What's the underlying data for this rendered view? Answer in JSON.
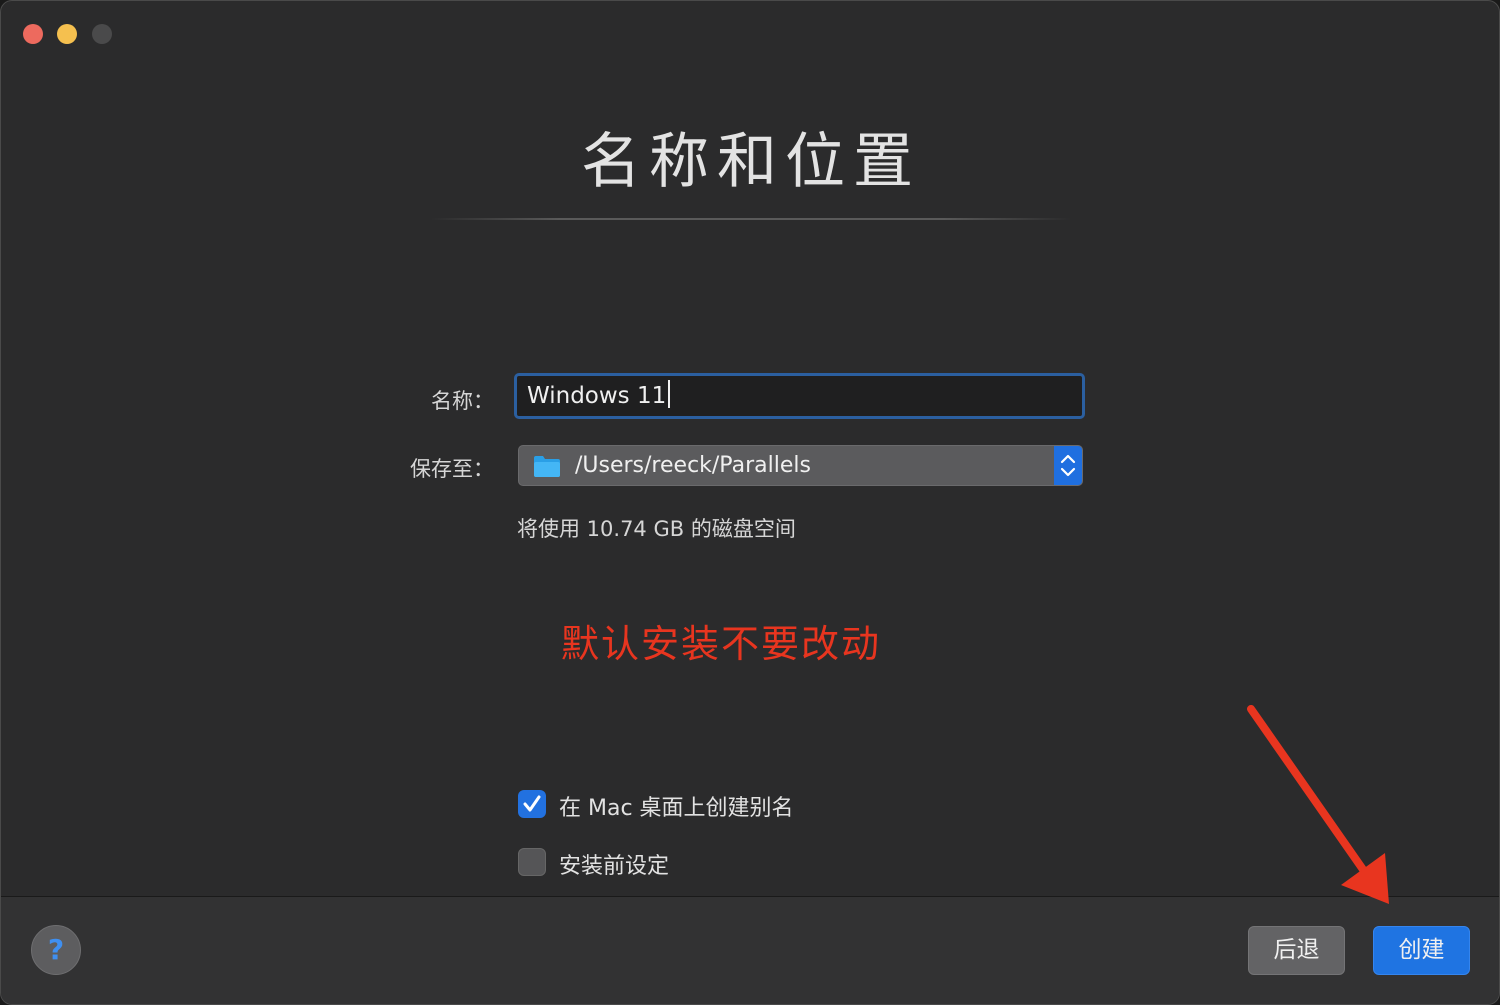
{
  "window": {
    "title": "名称和位置",
    "traffic_lights": {
      "close": "#ed6a5e",
      "minimize": "#f5c04f",
      "zoom": "#4a4a4b"
    }
  },
  "form": {
    "name_label": "名称：",
    "name_value": "Windows 11",
    "save_label": "保存至：",
    "save_path": "/Users/reeck/Parallels",
    "disk_note": "将使用 10.74 GB 的磁盘空间"
  },
  "annotation": {
    "text": "默认安装不要改动",
    "color": "#e8351f"
  },
  "options": [
    {
      "label": "在 Mac 桌面上创建别名",
      "checked": true
    },
    {
      "label": "安装前设定",
      "checked": false
    }
  ],
  "footer": {
    "help_label": "?",
    "back_label": "后退",
    "create_label": "创建"
  },
  "colors": {
    "accent": "#1f74e2",
    "background": "#2b2b2c"
  }
}
